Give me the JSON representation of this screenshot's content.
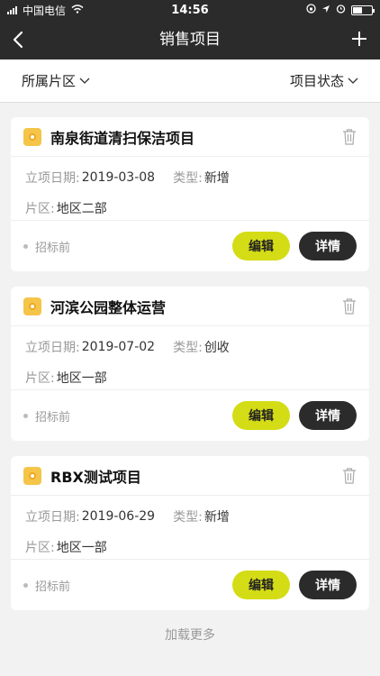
{
  "status_bar": {
    "carrier": "中国电信",
    "time": "14:56"
  },
  "nav": {
    "title": "销售项目"
  },
  "filters": {
    "area": "所属片区",
    "status": "项目状态"
  },
  "labels": {
    "date": "立项日期:",
    "type": "类型:",
    "area": "片区:",
    "edit": "编辑",
    "detail": "详情"
  },
  "projects": [
    {
      "name": "南泉街道清扫保洁项目",
      "date": "2019-03-08",
      "type": "新增",
      "area": "地区二部",
      "state": "招标前"
    },
    {
      "name": "河滨公园整体运营",
      "date": "2019-07-02",
      "type": "创收",
      "area": "地区一部",
      "state": "招标前"
    },
    {
      "name": "RBX测试项目",
      "date": "2019-06-29",
      "type": "新增",
      "area": "地区一部",
      "state": "招标前"
    }
  ],
  "load_more": "加载更多"
}
